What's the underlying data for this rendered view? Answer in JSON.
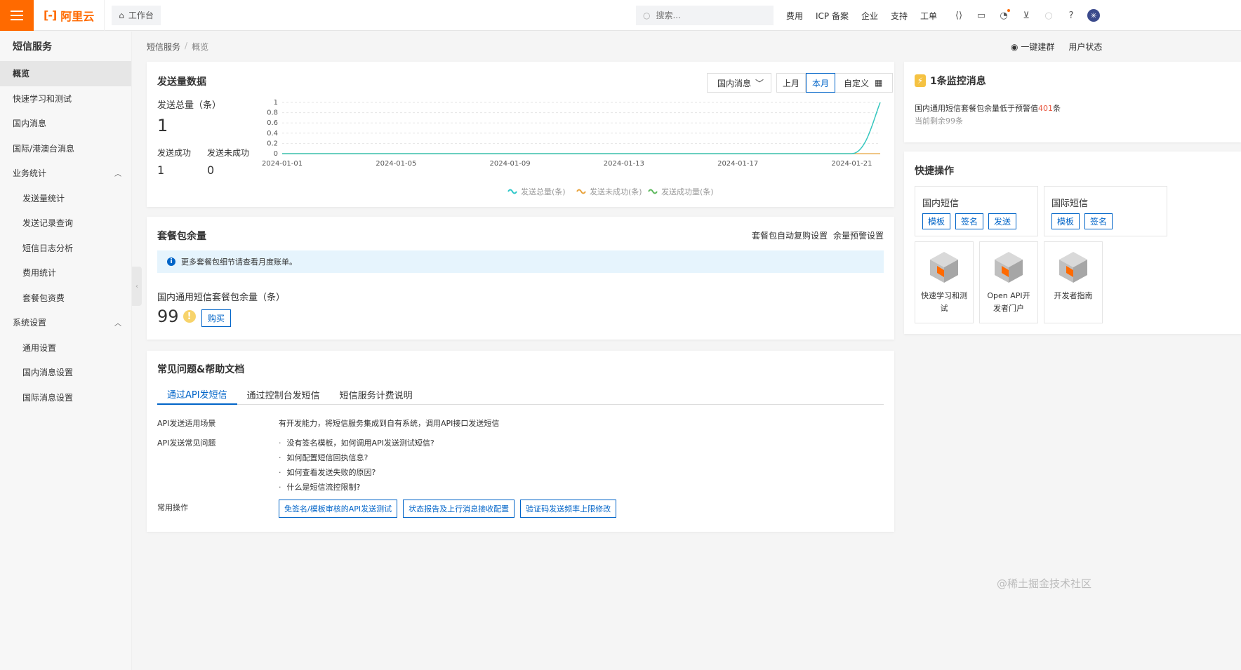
{
  "topbar": {
    "logo": "阿里云",
    "workbench": "工作台",
    "search_placeholder": "搜索...",
    "links": [
      "费用",
      "ICP 备案",
      "企业",
      "支持",
      "工单"
    ]
  },
  "sidebar": {
    "title": "短信服务",
    "items": [
      {
        "label": "概览"
      },
      {
        "label": "快速学习和测试"
      },
      {
        "label": "国内消息"
      },
      {
        "label": "国际/港澳台消息"
      },
      {
        "label": "业务统计"
      },
      {
        "label": "发送量统计"
      },
      {
        "label": "发送记录查询"
      },
      {
        "label": "短信日志分析"
      },
      {
        "label": "费用统计"
      },
      {
        "label": "套餐包资费"
      },
      {
        "label": "系统设置"
      },
      {
        "label": "通用设置"
      },
      {
        "label": "国内消息设置"
      },
      {
        "label": "国际消息设置"
      }
    ]
  },
  "breadcrumb": {
    "root": "短信服务",
    "current": "概览"
  },
  "header_actions": {
    "group": "一键建群",
    "user_status": "用户状态"
  },
  "send_card": {
    "title": "发送量数据",
    "select_value": "国内消息",
    "range_prev": "上月",
    "range_current": "本月",
    "range_custom": "自定义",
    "total_label": "发送总量（条）",
    "total_value": "1",
    "success_label": "发送成功",
    "success_value": "1",
    "fail_label": "发送未成功",
    "fail_value": "0"
  },
  "chart_data": {
    "type": "line",
    "x": [
      "2024-01-01",
      "2024-01-02",
      "2024-01-03",
      "2024-01-04",
      "2024-01-05",
      "2024-01-06",
      "2024-01-07",
      "2024-01-08",
      "2024-01-09",
      "2024-01-10",
      "2024-01-11",
      "2024-01-12",
      "2024-01-13",
      "2024-01-14",
      "2024-01-15",
      "2024-01-16",
      "2024-01-17",
      "2024-01-18",
      "2024-01-19",
      "2024-01-20",
      "2024-01-21",
      "2024-01-22"
    ],
    "x_ticks": [
      "2024-01-01",
      "2024-01-05",
      "2024-01-09",
      "2024-01-13",
      "2024-01-17",
      "2024-01-21"
    ],
    "y_ticks": [
      "0",
      "0.2",
      "0.4",
      "0.6",
      "0.8",
      "1"
    ],
    "ylim": [
      0,
      1
    ],
    "series": [
      {
        "name": "发送总量(条)",
        "color": "#2ec7c9",
        "values": [
          0,
          0,
          0,
          0,
          0,
          0,
          0,
          0,
          0,
          0,
          0,
          0,
          0,
          0,
          0,
          0,
          0,
          0,
          0,
          0,
          0,
          1
        ]
      },
      {
        "name": "发送未成功(条)",
        "color": "#e8a33d",
        "values": [
          0,
          0,
          0,
          0,
          0,
          0,
          0,
          0,
          0,
          0,
          0,
          0,
          0,
          0,
          0,
          0,
          0,
          0,
          0,
          0,
          0,
          0
        ]
      },
      {
        "name": "发送成功量(条)",
        "color": "#5cb85c",
        "values": [
          0,
          0,
          0,
          0,
          0,
          0,
          0,
          0,
          0,
          0,
          0,
          0,
          0,
          0,
          0,
          0,
          0,
          0,
          0,
          0,
          0,
          1
        ]
      }
    ],
    "grid": true,
    "legend": "bottom"
  },
  "pkg_card": {
    "title": "套餐包余量",
    "link_auto": "套餐包自动复购设置",
    "link_alert": "余量预警设置",
    "notice": "更多套餐包细节请查看月度账单。",
    "remain_label": "国内通用短信套餐包余量（条）",
    "remain_value": "99",
    "buy": "购买"
  },
  "faq_card": {
    "title": "常见问题&帮助文档",
    "tabs": [
      "通过API发短信",
      "通过控制台发短信",
      "短信服务计费说明"
    ],
    "scene_label": "API发送适用场景",
    "scene_desc": "有开发能力，将短信服务集成到自有系统，调用API接口发送短信",
    "faq_label": "API发送常见问题",
    "questions": [
      "没有签名模板，如何调用API发送测试短信?",
      "如何配置短信回执信息?",
      "如何查看发送失败的原因?",
      "什么是短信流控限制?"
    ],
    "ops_label": "常用操作",
    "ops": [
      "免签名/模板审核的API发送测试",
      "状态报告及上行消息接收配置",
      "验证码发送频率上限修改"
    ]
  },
  "monitor_card": {
    "title": "1条监控消息",
    "msg_prefix": "国内通用短信套餐包余量低于预警值",
    "msg_num": "401",
    "msg_suffix": "条",
    "sub": "当前剩余99条"
  },
  "quick_card": {
    "title": "快捷操作",
    "domestic": {
      "title": "国内短信",
      "btns": [
        "模板",
        "签名",
        "发送"
      ]
    },
    "intl": {
      "title": "国际短信",
      "btns": [
        "模板",
        "签名"
      ]
    },
    "tiles": [
      "快速学习和测试",
      "Open API开发者门户",
      "开发者指南"
    ]
  },
  "watermark": "@稀土掘金技术社区"
}
